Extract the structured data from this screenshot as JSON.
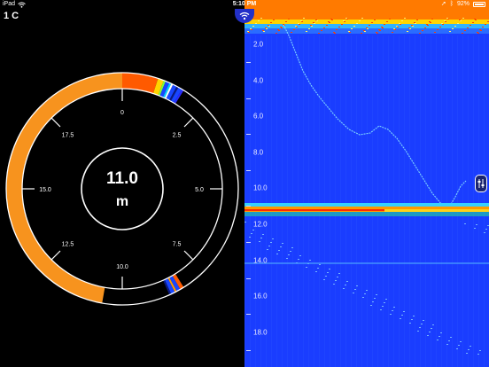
{
  "status": {
    "device": "iPad",
    "time": "5:10 PM",
    "battery": "92%"
  },
  "temperature": "1 C",
  "gauge": {
    "value": "11.0",
    "unit": "m",
    "scale_labels": [
      "0",
      "2.5",
      "5.0",
      "7.5",
      "10.0",
      "12.5",
      "15.0",
      "17.5"
    ],
    "colors": {
      "bottom_band": "#f7931e",
      "fish_red": "#ff5a00",
      "fish_blue": "#1846ff",
      "ring": "#ffffff"
    }
  },
  "sonar": {
    "depth_labels": [
      "2.0",
      "4.0",
      "6.0",
      "8.0",
      "10.0",
      "12.0",
      "14.0",
      "16.0",
      "18.0"
    ],
    "background_color": "#1a3dff",
    "surface_color": "#ff7a00",
    "bottom_color": "#ff9a00"
  },
  "icons": {
    "wifi": "wifi-icon",
    "settings": "sliders-icon"
  }
}
